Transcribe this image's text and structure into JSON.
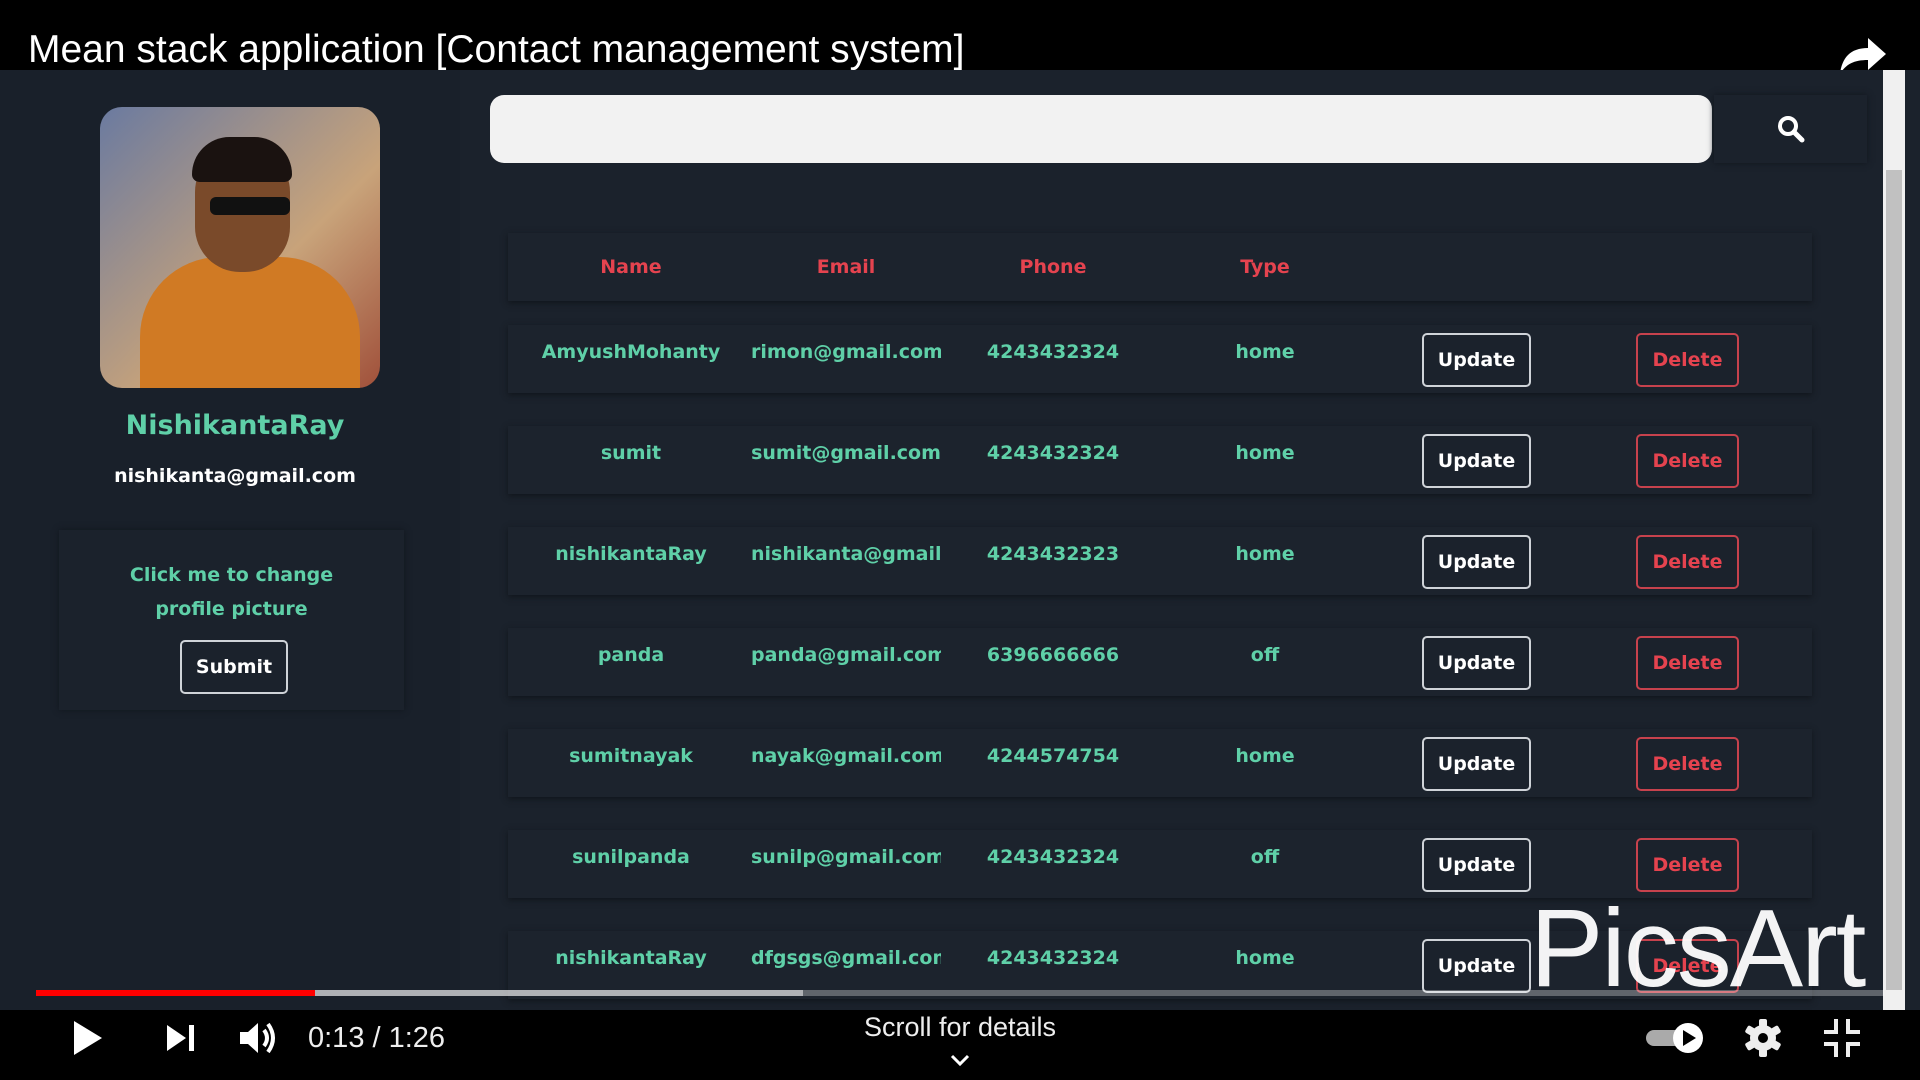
{
  "video": {
    "title": "Mean stack application [Contact management system]",
    "current_time": "0:13",
    "duration": "1:26",
    "time_display": "0:13 / 1:26",
    "progress_percent": 15.1,
    "buffered_percent": 41.5,
    "scroll_hint": "Scroll for details",
    "watermark": "PicsArt"
  },
  "profile": {
    "name": "NishikantaRay",
    "email": "nishikanta@gmail.com",
    "change_picture_label": "Click me to change profile picture",
    "submit_label": "Submit"
  },
  "search": {
    "value": "",
    "placeholder": ""
  },
  "table": {
    "headers": [
      "Name",
      "Email",
      "Phone",
      "Type"
    ],
    "update_label": "Update",
    "delete_label": "Delete",
    "rows": [
      {
        "name": "AmyushMohanty",
        "email": "rimon@gmail.com",
        "phone": "4243432324",
        "type": "home"
      },
      {
        "name": "sumit",
        "email": "sumit@gmail.com",
        "phone": "4243432324",
        "type": "home"
      },
      {
        "name": "nishikantaRay",
        "email": "nishikanta@gmail.com",
        "phone": "4243432323",
        "type": "home"
      },
      {
        "name": "panda",
        "email": "panda@gmail.com",
        "phone": "6396666666",
        "type": "off"
      },
      {
        "name": "sumitnayak",
        "email": "nayak@gmail.com",
        "phone": "4244574754",
        "type": "home"
      },
      {
        "name": "sunilpanda",
        "email": "sunilp@gmail.com",
        "phone": "4243432324",
        "type": "off"
      },
      {
        "name": "nishikantaRay",
        "email": "dfgsgs@gmail.com",
        "phone": "4243432324",
        "type": "home"
      }
    ]
  },
  "colors": {
    "accent_green": "#5fd0a8",
    "accent_red": "#e5434f",
    "background": "#1b222c",
    "progress": "#ff0000"
  }
}
